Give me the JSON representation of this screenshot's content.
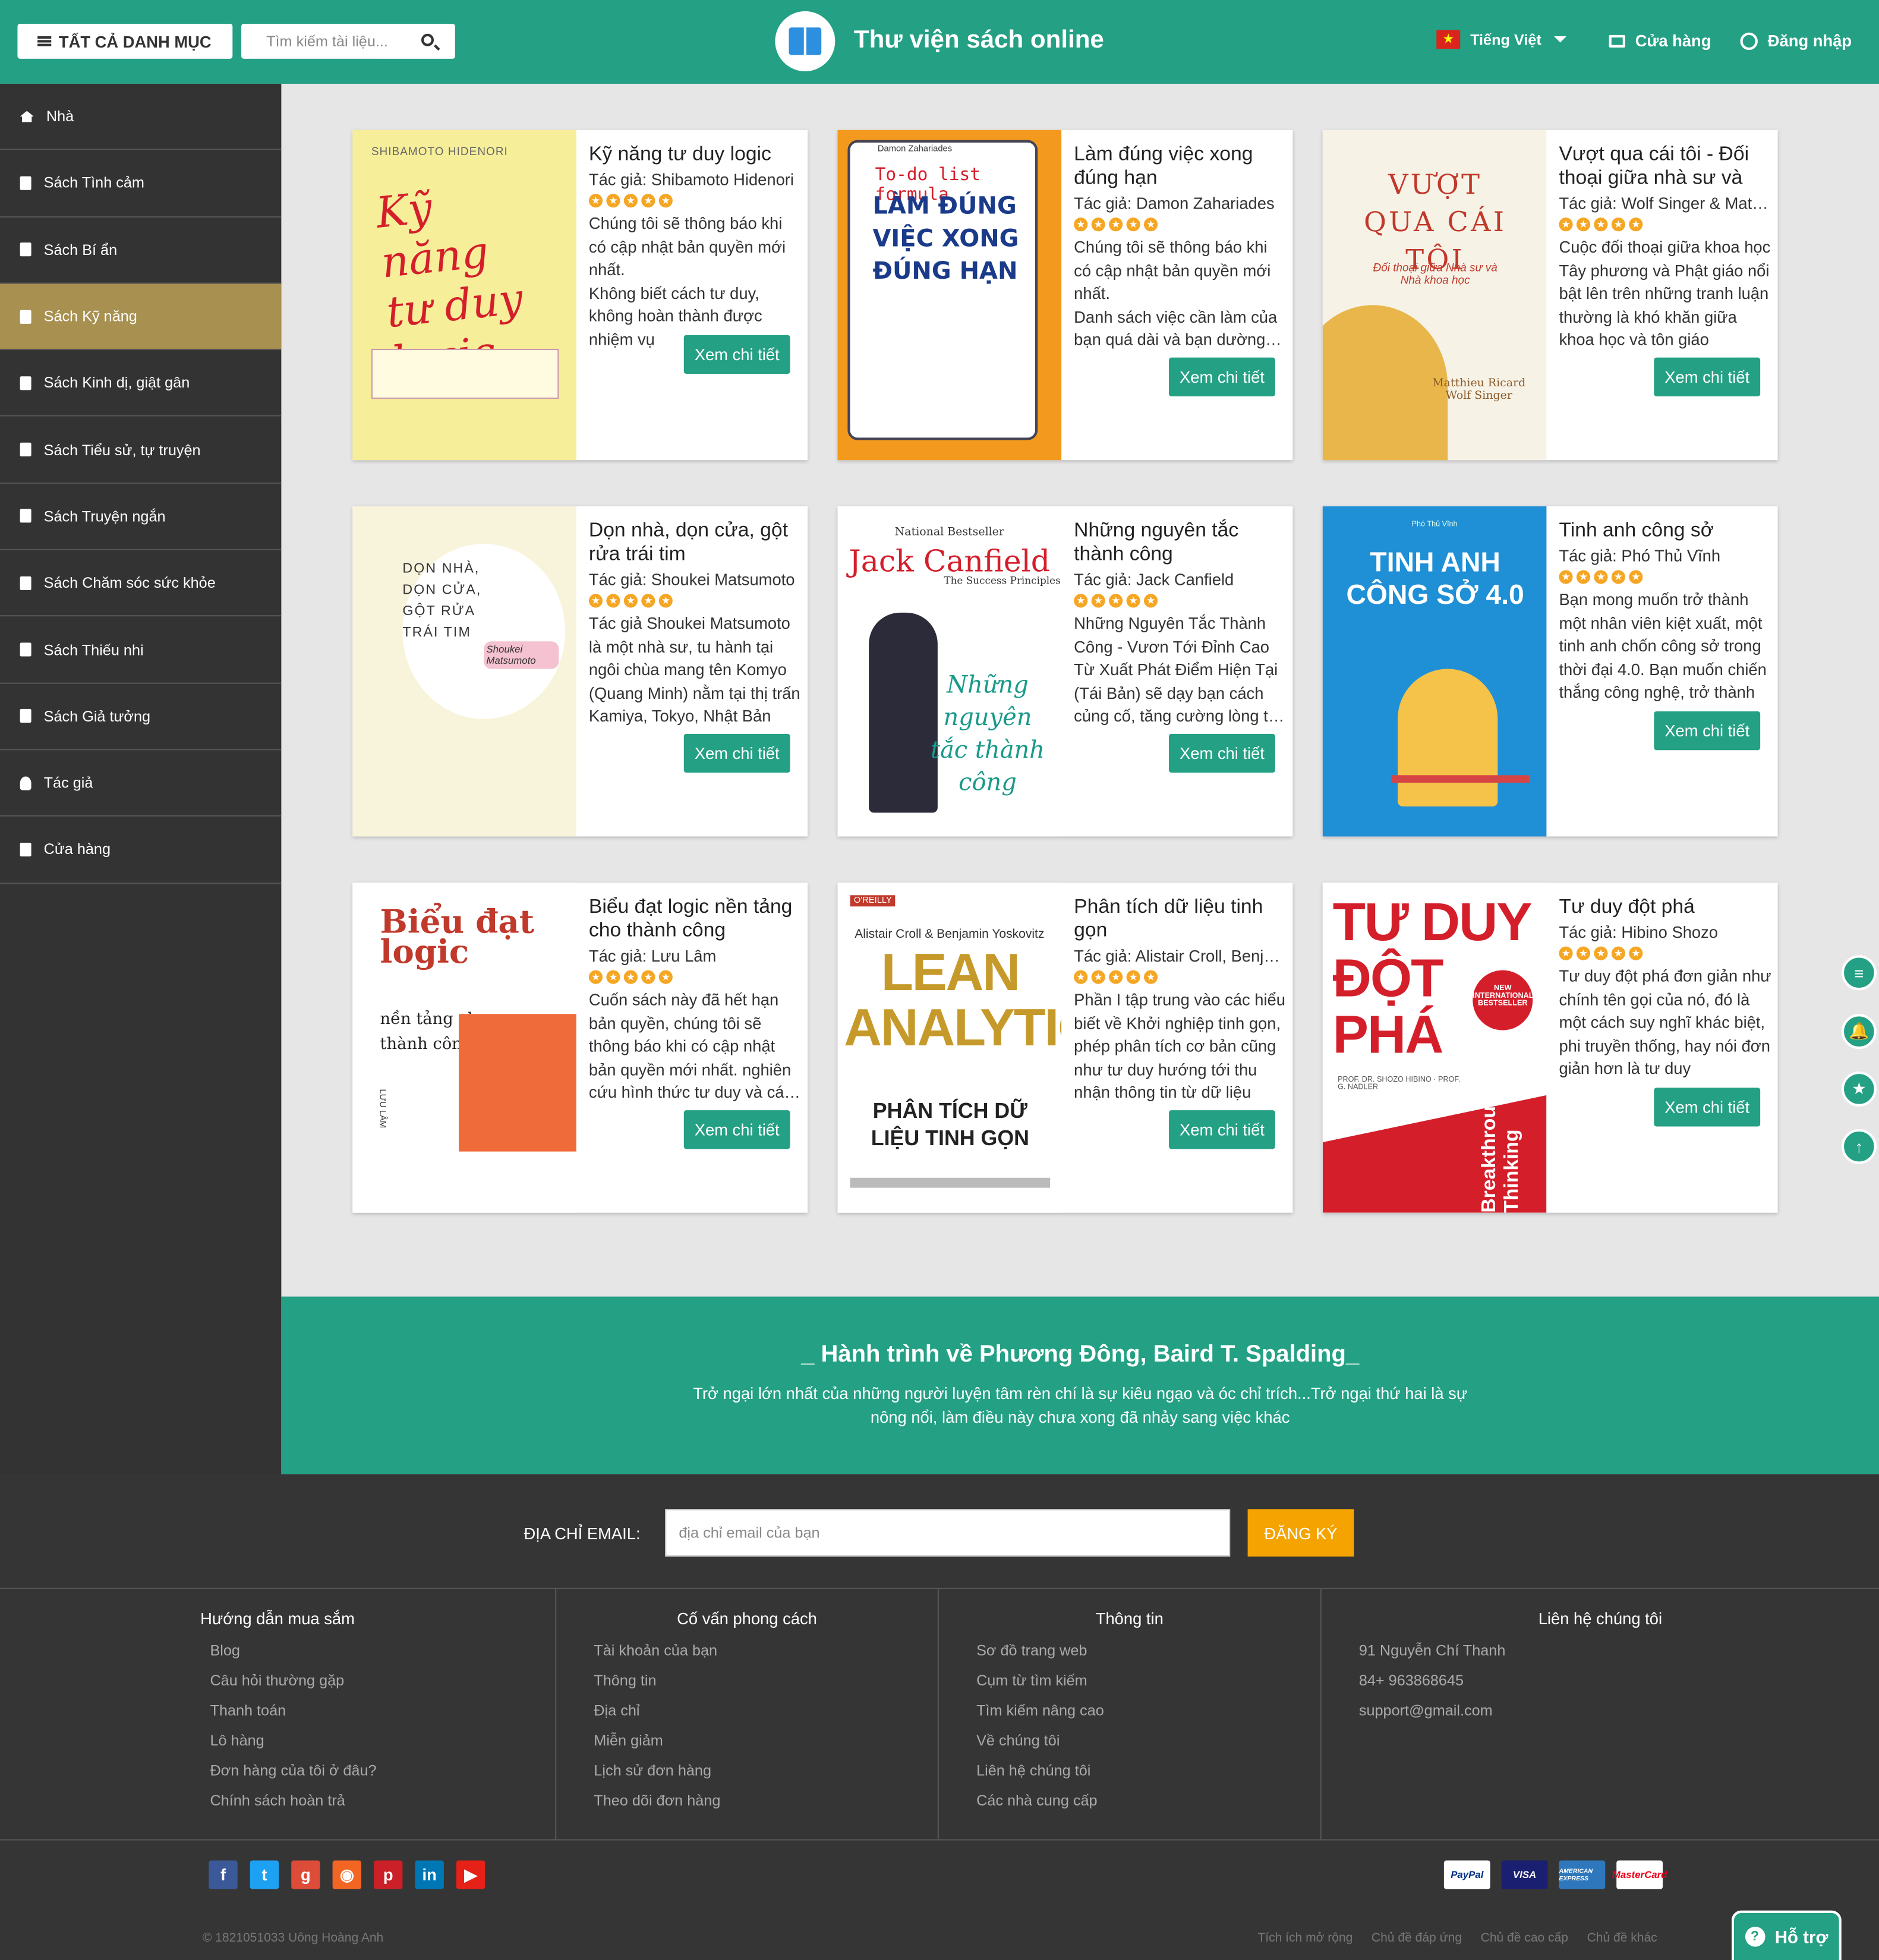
{
  "header": {
    "categories_label": "TẤT CẢ DANH MỤC",
    "search_placeholder": "Tìm kiếm tài liệu...",
    "site_title": "Thư viện sách online",
    "language": "Tiếng Việt",
    "store_label": "Cửa hàng",
    "login_label": "Đăng nhập"
  },
  "sidebar": {
    "items": [
      {
        "label": "Nhà",
        "icon": "home-icon"
      },
      {
        "label": "Sách Tình cảm",
        "icon": "book-icon"
      },
      {
        "label": "Sách Bí ẩn",
        "icon": "book-icon"
      },
      {
        "label": "Sách Kỹ năng",
        "icon": "book-icon"
      },
      {
        "label": "Sách Kinh dị, giật gân",
        "icon": "book-icon"
      },
      {
        "label": "Sách Tiểu sử, tự truyện",
        "icon": "book-icon"
      },
      {
        "label": "Sách Truyện ngắn",
        "icon": "book-icon"
      },
      {
        "label": "Sách Chăm sóc sức khỏe",
        "icon": "book-icon"
      },
      {
        "label": "Sách Thiếu nhi",
        "icon": "book-icon"
      },
      {
        "label": "Sách Giả tưởng",
        "icon": "book-icon"
      },
      {
        "label": "Tác giả",
        "icon": "user-icon"
      },
      {
        "label": "Cửa hàng",
        "icon": "bag-icon"
      }
    ],
    "active_index": 3
  },
  "books": [
    {
      "title": "Kỹ năng tư duy logic",
      "author": "Tác giả: Shibamoto Hidenori",
      "desc": "Chúng tôi sẽ thông báo khi có cập nhật bản quyền mới nhất.\nKhông biết cách tư duy, không hoàn thành được nhiệm vụ",
      "button": "Xem chi tiết",
      "cover": {
        "top": "SHIBAMOTO HIDENORI",
        "main": "Kỹ năng tư duy logic",
        "bg": "#f7ee9a"
      }
    },
    {
      "title": "Làm đúng việc xong đúng hạn",
      "author": "Tác giả: Damon Zahariades",
      "desc": "Chúng tôi sẽ thông báo khi có cập nhật bản quyền mới nhất.\nDanh sách việc cần làm của bạn quá dài và bạn dường như",
      "button": "Xem chi tiết",
      "cover": {
        "top": "Damon Zahariades",
        "main": "LÀM ĐÚNG VIỆC XONG ĐÚNG HẠN",
        "sub": "To-do list formula",
        "bg": "#f39a1e"
      }
    },
    {
      "title": "Vượt qua cái tôi - Đối thoại giữa nhà sư và nhà khoa học",
      "author": "Tác giả: Wolf Singer & Matthieu Ricard",
      "desc": "Cuộc đối thoại giữa khoa học Tây phương và Phật giáo nổi bật lên trên những tranh luận thường là khó khăn giữa khoa học và tôn giáo",
      "button": "Xem chi tiết",
      "cover": {
        "main": "VƯỢT QUA CÁI TÔI",
        "sub": "Đối thoại giữa Nhà sư và Nhà khoa học",
        "author": "Matthieu Ricard Wolf Singer",
        "bg": "#f7f2e6"
      }
    },
    {
      "title": "Dọn nhà, dọn cửa, gột rửa trái tim",
      "author": "Tác giả: Shoukei Matsumoto",
      "desc": "Tác giả Shoukei Matsumoto là một nhà sư, tu hành tại ngôi chùa mang tên Komyo (Quang Minh) nằm tại thị trấn Kamiya, Tokyo, Nhật Bản",
      "button": "Xem chi tiết",
      "cover": {
        "main": "DỌN NHÀ, DỌN CỬA, GỘT RỬA TRÁI TIM",
        "author": "Shoukei Matsumoto",
        "bg": "#f8f4dc"
      }
    },
    {
      "title": "Những nguyên tắc thành công",
      "author": "Tác giả: Jack Canfield",
      "desc": "Những Nguyên Tắc Thành Công - Vươn Tới Đỉnh Cao Từ Xuất Phát Điểm Hiện Tại (Tái Bản) sẽ dạy bạn cách củng cố, tăng cường lòng tự tin",
      "button": "Xem chi tiết",
      "cover": {
        "top": "National Bestseller",
        "author": "Jack Canfield",
        "sub": "The Success Principles",
        "main": "Những nguyên tắc thành công",
        "bg": "#ffffff"
      }
    },
    {
      "title": "Tinh anh công sở",
      "author": "Tác giả: Phó Thủ Vĩnh",
      "desc": "Bạn mong muốn trở thành một nhân viên kiệt xuất, một tinh anh chốn công sở trong thời đại 4.0. Bạn muốn chiến thắng công nghệ, trở thành",
      "button": "Xem chi tiết",
      "cover": {
        "top": "Phó Thủ Vĩnh",
        "main": "TINH ANH CÔNG SỞ 4.0",
        "bg": "#1f8fd6"
      }
    },
    {
      "title": "Biểu đạt logic nền tảng cho thành công",
      "author": "Tác giả: Lưu Lâm",
      "desc": "Cuốn sách này đã hết hạn bản quyền, chúng tôi sẽ thông báo khi có cập nhật bản quyền mới nhất. nghiên cứu hình thức tư duy và các quy luật",
      "button": "Xem chi tiết",
      "cover": {
        "main": "Biểu đạt logic",
        "sub": "nền tảng cho thành công",
        "author": "LƯU LÂM",
        "bg": "#ffffff"
      }
    },
    {
      "title": "Phân tích dữ liệu tinh gọn",
      "author": "Tác giả: Alistair Croll, Benjamin Yoskovitz",
      "desc": "Phần I tập trung vào các hiểu biết về Khởi nghiệp tinh gọn, phép phân tích cơ bản cũng như tư duy hướng tới thu nhận thông tin từ dữ liệu",
      "button": "Xem chi tiết",
      "cover": {
        "top": "O'REILLY",
        "author": "Alistair Croll & Benjamin Yoskovitz",
        "main": "LEAN ANALYTICS",
        "sub": "PHÂN TÍCH DỮ LIỆU TINH GỌN",
        "bg": "#ffffff"
      }
    },
    {
      "title": "Tư duy đột phá",
      "author": "Tác giả: Hibino Shozo",
      "desc": "Tư duy đột phá đơn giản như chính tên gọi của nó, đó là một cách suy nghĩ khác biệt, phi truyền thống, hay nói đơn giản hơn là tư duy",
      "button": "Xem chi tiết",
      "cover": {
        "main": "TƯ DUY ĐỘT PHÁ",
        "sub": "Breakthrough Thinking",
        "badge": "NEW INTERNATIONAL BESTSELLER",
        "author": "PROF. DR. SHOZO HIBINO · PROF. G. NADLER",
        "bg": "#ffffff"
      }
    }
  ],
  "quote": {
    "title": "_ Hành trình về Phương Đông, Baird T. Spalding_",
    "text": "Trở ngại lớn nhất của những người luyện tâm rèn chí là sự kiêu ngạo và óc chỉ trích...Trở ngại thứ hai là sự nông nổi, làm điều này chưa xong đã nhảy sang việc khác"
  },
  "newsletter": {
    "label": "ĐỊA CHỈ EMAIL:",
    "placeholder": "địa chỉ email của bạn",
    "button": "ĐĂNG KÝ"
  },
  "footer_columns": [
    {
      "title": "Hướng dẫn mua sắm",
      "items": [
        "Blog",
        "Câu hỏi thường gặp",
        "Thanh toán",
        "Lô hàng",
        "Đơn hàng của tôi ở đâu?",
        "Chính sách hoàn trả"
      ]
    },
    {
      "title": "Cố vấn phong cách",
      "items": [
        "Tài khoản của bạn",
        "Thông tin",
        "Địa chỉ",
        "Miễn giảm",
        "Lịch sử đơn hàng",
        "Theo dõi đơn hàng"
      ]
    },
    {
      "title": "Thông tin",
      "items": [
        "Sơ đồ trang web",
        "Cụm từ tìm kiếm",
        "Tìm kiếm nâng cao",
        "Về chúng tôi",
        "Liên hệ chúng tôi",
        "Các nhà cung cấp"
      ]
    },
    {
      "title": "Liên hệ chúng tôi",
      "items": [
        "91 Nguyễn Chí Thanh",
        "84+ 963868645",
        "support@gmail.com"
      ]
    }
  ],
  "social": [
    {
      "name": "facebook-icon",
      "glyph": "f",
      "color": "#3b5998"
    },
    {
      "name": "twitter-icon",
      "glyph": "t",
      "color": "#1da1f2"
    },
    {
      "name": "google-plus-icon",
      "glyph": "g",
      "color": "#dd4b39"
    },
    {
      "name": "rss-icon",
      "glyph": "◉",
      "color": "#f26522"
    },
    {
      "name": "pinterest-icon",
      "glyph": "p",
      "color": "#cb2027"
    },
    {
      "name": "linkedin-icon",
      "glyph": "in",
      "color": "#0077b5"
    },
    {
      "name": "youtube-icon",
      "glyph": "▶",
      "color": "#e62117"
    }
  ],
  "payments": [
    {
      "name": "paypal-icon",
      "label": "PayPal",
      "bg": "#ffffff",
      "fg": "#003087"
    },
    {
      "name": "visa-icon",
      "label": "VISA",
      "bg": "#1a1f71",
      "fg": "#ffffff"
    },
    {
      "name": "amex-icon",
      "label": "AMERICAN EXPRESS",
      "bg": "#2e77bc",
      "fg": "#ffffff"
    },
    {
      "name": "mastercard-icon",
      "label": "MasterCard",
      "bg": "#ffffff",
      "fg": "#eb001b"
    }
  ],
  "copyright": "© 1821051033 Uông Hoàng Anh",
  "bottom_links": [
    "Tích ích mở rộng",
    "Chủ đề đáp ứng",
    "Chủ đề cao cấp",
    "Chủ đề khác"
  ],
  "help_label": "Hỗ trợ",
  "float_buttons": [
    {
      "name": "document-icon",
      "glyph": "≡"
    },
    {
      "name": "bell-icon",
      "glyph": "🔔"
    },
    {
      "name": "star-icon",
      "glyph": "★"
    },
    {
      "name": "arrow-up-icon",
      "glyph": "↑"
    }
  ],
  "colors": {
    "primary": "#24a084",
    "active": "#a89050",
    "sidebar": "#333333",
    "accent": "#f5a300"
  }
}
